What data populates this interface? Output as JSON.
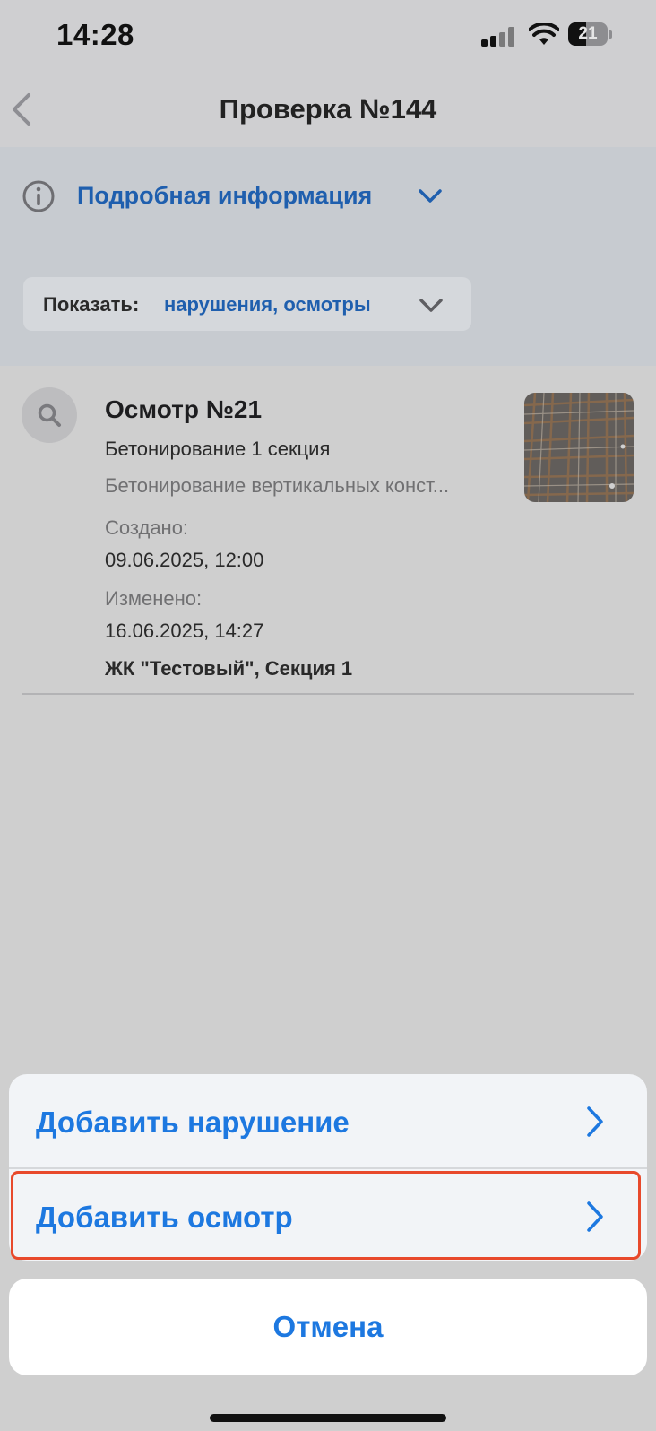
{
  "status_bar": {
    "time": "14:28",
    "battery_level": "21"
  },
  "nav": {
    "title": "Проверка №144"
  },
  "details": {
    "label": "Подробная информация"
  },
  "filter": {
    "prefix": "Показать:",
    "value": "нарушения, осмотры"
  },
  "item": {
    "title": "Осмотр №21",
    "subtitle": "Бетонирование 1 секция",
    "description": "Бетонирование вертикальных конст...",
    "created_label": "Создано:",
    "created_value": "09.06.2025, 12:00",
    "modified_label": "Изменено:",
    "modified_value": "16.06.2025, 14:27",
    "location": "ЖК \"Тестовый\", Секция 1"
  },
  "action_sheet": {
    "add_violation": "Добавить нарушение",
    "add_inspection": "Добавить осмотр",
    "cancel": "Отмена"
  },
  "colors": {
    "accent": "#1d78e0",
    "link_dimmed": "#1f5fae",
    "highlight_border": "#e8492b"
  }
}
